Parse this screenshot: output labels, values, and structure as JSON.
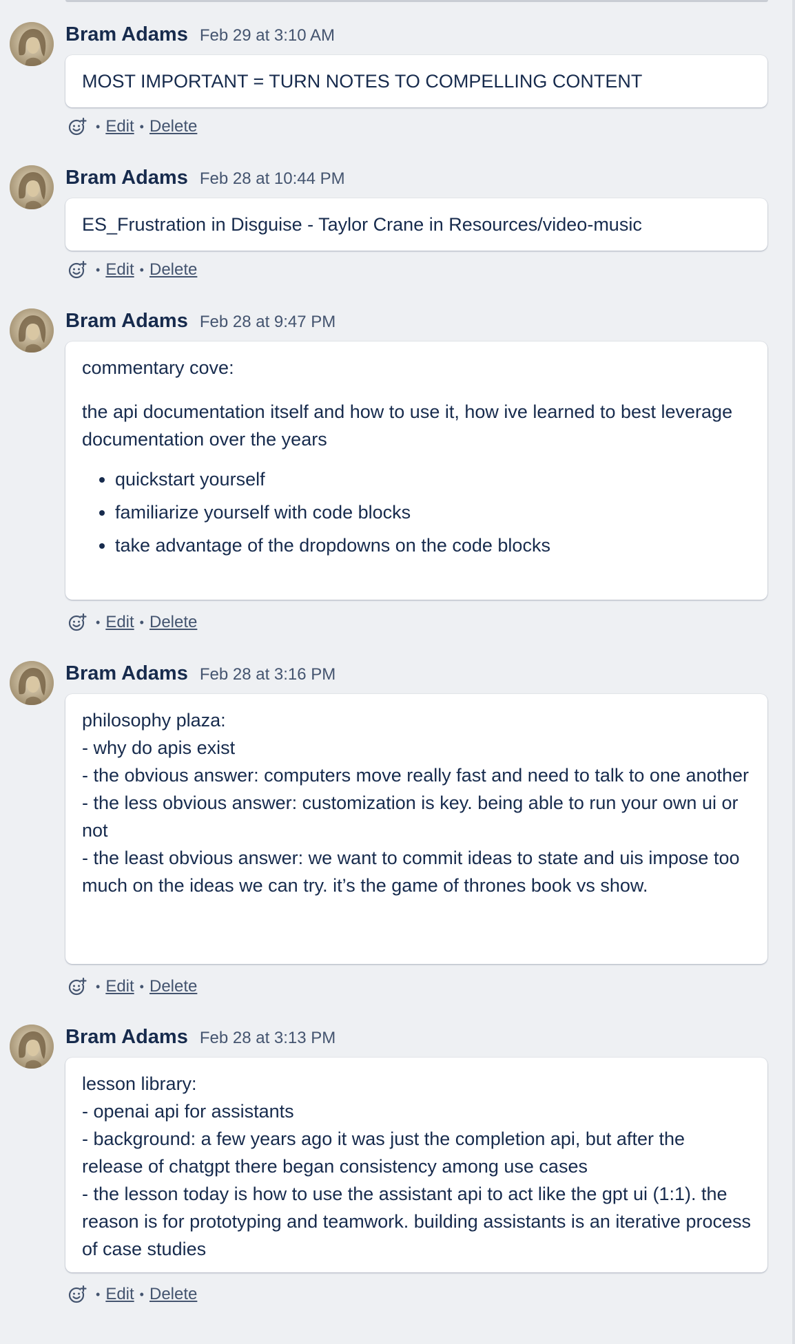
{
  "comments": [
    {
      "author": "Bram Adams",
      "date": "Feb 29 at 3:10 AM",
      "paragraphs": [
        "MOST IMPORTANT = TURN NOTES TO COMPELLING CONTENT"
      ],
      "edit_label": "Edit",
      "delete_label": "Delete"
    },
    {
      "author": "Bram Adams",
      "date": "Feb 28 at 10:44 PM",
      "paragraphs": [
        "ES_Frustration in Disguise - Taylor Crane in Resources/video-music"
      ],
      "edit_label": "Edit",
      "delete_label": "Delete"
    },
    {
      "author": "Bram Adams",
      "date": "Feb 28 at 9:47 PM",
      "paragraphs": [
        "commentary cove:",
        "the api documentation itself and how to use it, how ive learned to best leverage documentation over the years"
      ],
      "bullets": [
        "quickstart yourself",
        "familiarize yourself with code blocks",
        "take advantage of the dropdowns on the code blocks"
      ],
      "edit_label": "Edit",
      "delete_label": "Delete"
    },
    {
      "author": "Bram Adams",
      "date": "Feb 28 at 3:16 PM",
      "lines": [
        "philosophy plaza:",
        "- why do apis exist",
        "- the obvious answer: computers move really fast and need to talk to one another",
        "- the less obvious answer: customization is key. being able to run your own ui or not",
        "- the least obvious answer: we want to commit ideas to state and uis impose too much on the ideas we can try. it’s the game of thrones book vs show."
      ],
      "edit_label": "Edit",
      "delete_label": "Delete"
    },
    {
      "author": "Bram Adams",
      "date": "Feb 28 at 3:13 PM",
      "lines": [
        "lesson library:",
        "- openai api for assistants",
        "- background: a few years ago it was just the completion api, but after the release of chatgpt there began consistency among use cases",
        "- the lesson today is how to use the assistant api to act like the gpt ui (1:1). the reason is for prototyping and teamwork. building assistants is an iterative process of case studies"
      ],
      "edit_label": "Edit",
      "delete_label": "Delete"
    }
  ],
  "separator": "•",
  "icons": {
    "reaction": "add-reaction-icon",
    "avatar": "user-avatar-portrait"
  },
  "colors": {
    "background": "#eef0f3",
    "card": "#ffffff",
    "text": "#172b4d",
    "muted": "#44546f"
  }
}
